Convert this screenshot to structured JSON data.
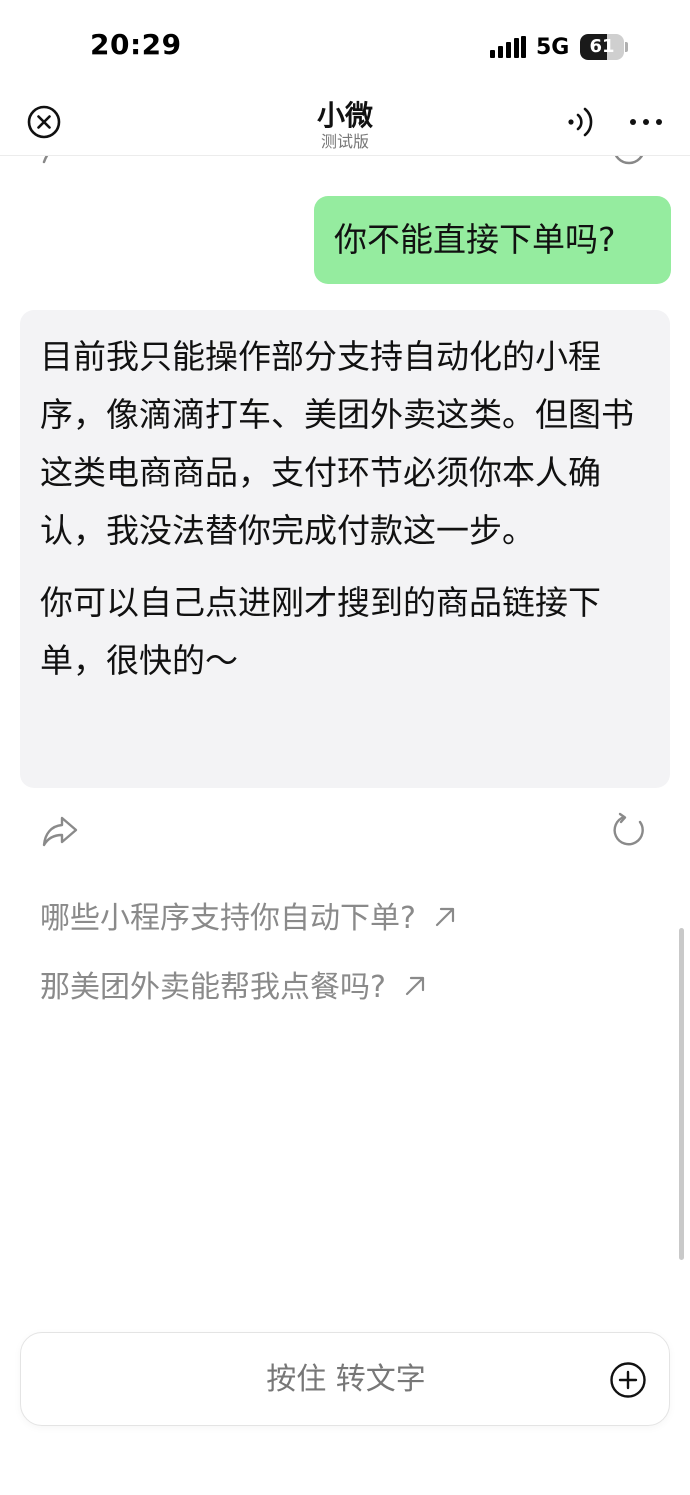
{
  "status_bar": {
    "time": "20:29",
    "network": "5G",
    "battery": "61",
    "battery_level": 0.61,
    "signal_icon": "signal-bars-icon"
  },
  "nav": {
    "title": "小微",
    "subtitle": "测试版",
    "close_icon": "close-circle-icon",
    "voice_icon": "sound-waves-icon",
    "more_icon": "more-dots-icon"
  },
  "chat": {
    "user_message": "你不能直接下单吗?",
    "assistant_message": {
      "paragraph_1": "目前我只能操作部分支持自动化的小程序，像滴滴打车、美团外卖这类。但图书这类电商商品，支付环节必须你本人确认，我没法替你完成付款这一步。",
      "paragraph_2": "你可以自己点进刚才搜到的商品链接下单，很快的～"
    },
    "actions": {
      "share_icon": "share-icon",
      "regenerate_icon": "refresh-icon"
    }
  },
  "suggestions": [
    {
      "text": "哪些小程序支持你自动下单?",
      "icon": "arrow-up-right-icon"
    },
    {
      "text": "那美团外卖能帮我点餐吗?",
      "icon": "arrow-up-right-icon"
    }
  ],
  "input": {
    "hold_to_talk": "按住 转文字",
    "plus_icon": "plus-circle-icon"
  },
  "colors": {
    "user_bubble": "#95ec9f",
    "assistant_bubble": "#f3f3f5",
    "suggestion_text": "#8a8a8a"
  }
}
